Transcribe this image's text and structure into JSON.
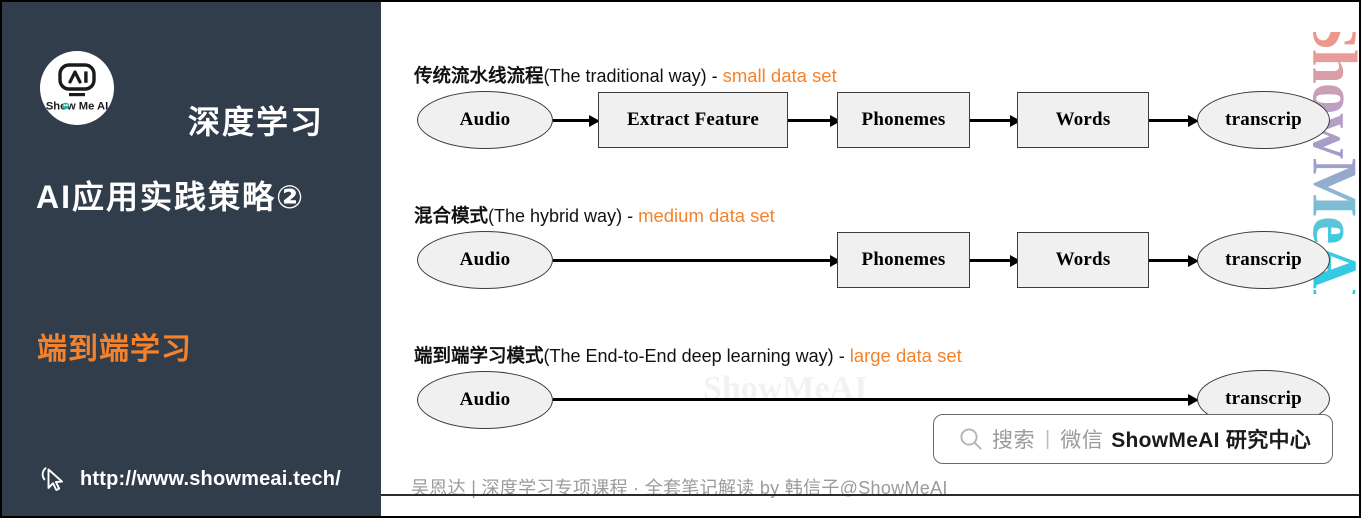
{
  "sidebar": {
    "logo": {
      "icon": "show-me-ai-robot-logo",
      "wordmark": "Show Me AI"
    },
    "title_line1": "深度学习",
    "title_line2": "AI应用实践策略②",
    "highlight": "端到端学习",
    "url": "http://www.showmeai.tech/",
    "cursor_icon": "mouse-pointer-icon",
    "bg_color": "#323d4c",
    "accent_color": "#f5822a"
  },
  "main": {
    "vertical_watermark": "ShowMeAI",
    "center_watermark": "ShowMeAI",
    "sections": [
      {
        "cn": "传统流水线流程",
        "en": "(The  traditional way)",
        "dash": " - ",
        "tag": "small data set",
        "nodes": [
          {
            "label": "Audio",
            "shape": "ellipse"
          },
          {
            "label": "Extract Feature",
            "shape": "rect"
          },
          {
            "label": "Phonemes",
            "shape": "rect"
          },
          {
            "label": "Words",
            "shape": "rect"
          },
          {
            "label": "transcrip",
            "shape": "ellipse"
          }
        ]
      },
      {
        "cn": "混合模式",
        "en": "(The  hybrid way)",
        "dash": " - ",
        "tag": "medium data set",
        "nodes": [
          {
            "label": "Audio",
            "shape": "ellipse"
          },
          {
            "label": "Phonemes",
            "shape": "rect"
          },
          {
            "label": "Words",
            "shape": "rect"
          },
          {
            "label": "transcrip",
            "shape": "ellipse"
          }
        ]
      },
      {
        "cn": "端到端学习模式",
        "en": "(The  End-to-End deep learning way)",
        "dash": " - ",
        "tag": "large data set",
        "nodes": [
          {
            "label": "Audio",
            "shape": "ellipse"
          },
          {
            "label": "transcrip",
            "shape": "ellipse"
          }
        ]
      }
    ],
    "search": {
      "icon": "search-icon",
      "label": "搜索",
      "separator": "|",
      "channel": "微信",
      "brand": "ShowMeAI 研究中心"
    },
    "footer": "吴恩达 | 深度学习专项课程 · 全套笔记解读  by 韩信子@ShowMeAI"
  }
}
